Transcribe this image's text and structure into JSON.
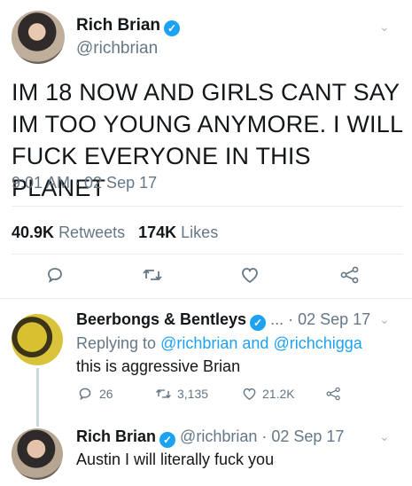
{
  "main_tweet": {
    "name": "Rich Brian",
    "handle": "@richbrian",
    "text": "IM 18 NOW AND GIRLS CANT SAY IM TOO YOUNG ANYMORE. I WILL FUCK EVERYONE IN THIS PLANET",
    "time": "9:01 AM · 02 Sep 17",
    "retweets_count": "40.9K",
    "retweets_label": "Retweets",
    "likes_count": "174K",
    "likes_label": "Likes"
  },
  "reply1": {
    "name": "Beerbongs & Bentleys",
    "handle": "...",
    "date": "· 02 Sep 17",
    "replying_prefix": "Replying to",
    "replying_to_1": "@richbrian",
    "replying_and": "and",
    "replying_to_2": "@richchigga",
    "text": "this is aggressive Brian",
    "replies": "26",
    "retweets": "3,135",
    "likes": "21.2K"
  },
  "reply2": {
    "name": "Rich Brian",
    "handle": "@richbrian",
    "date": "· 02 Sep 17",
    "text": "Austin I will literally fuck you"
  },
  "icons": {
    "reply": "reply-icon",
    "retweet": "retweet-icon",
    "like": "heart-icon",
    "share": "share-icon",
    "verified": "verified-badge-icon",
    "chevron": "chevron-down-icon"
  },
  "colors": {
    "accent": "#1da1f2",
    "secondary_text": "#657786",
    "primary_text": "#14171a"
  }
}
